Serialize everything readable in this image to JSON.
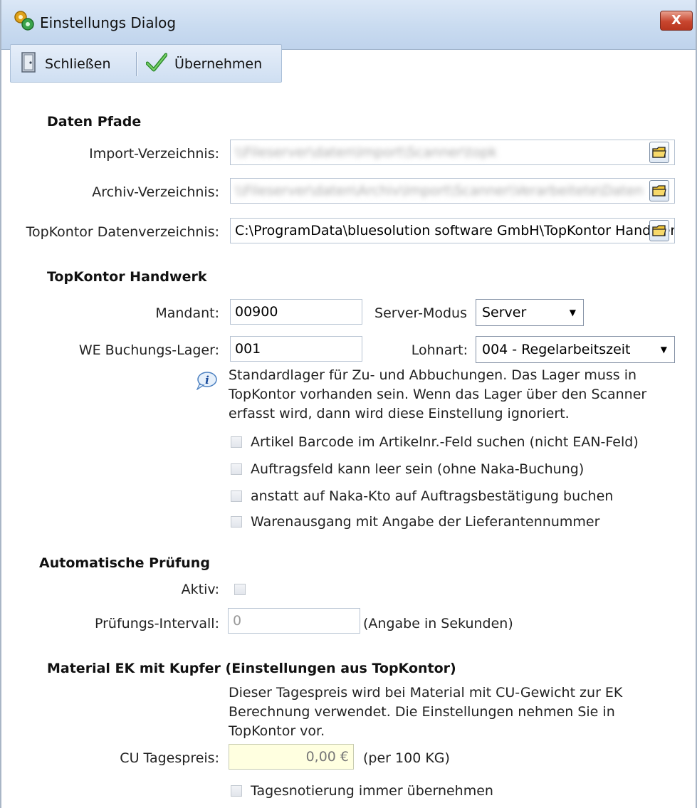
{
  "window": {
    "title": "Einstellungs Dialog",
    "close_symbol": "X"
  },
  "toolbar": {
    "close_label": "Schließen",
    "apply_label": "Übernehmen"
  },
  "paths": {
    "heading": "Daten Pfade",
    "import_label": "Import-Verzeichnis:",
    "import_value": "\\\\Fileserver\\daten\\Import\\Scanner\\topk",
    "archive_label": "Archiv-Verzeichnis:",
    "archive_value": "\\\\Fileserver\\daten\\Archiv\\Import\\Scanner\\Verarbeitete\\Daten",
    "topkontor_label": "TopKontor Datenverzeichnis:",
    "topkontor_value": "C:\\ProgramData\\bluesolution software GmbH\\TopKontor Handwerk"
  },
  "handwerk": {
    "heading": "TopKontor Handwerk",
    "mandant_label": "Mandant:",
    "mandant_value": "00900",
    "server_mode_label": "Server-Modus",
    "server_mode_value": "Server",
    "lager_label": "WE Buchungs-Lager:",
    "lager_value": "001",
    "lohnart_label": "Lohnart:",
    "lohnart_value": "004 - Regelarbeitszeit",
    "info_lines": [
      "Standardlager für Zu- und Abbuchungen. Das Lager muss in",
      "TopKontor vorhanden sein. Wenn das Lager über den Scanner",
      "erfasst wird, dann wird diese Einstellung ignoriert."
    ],
    "checkboxes": [
      "Artikel Barcode im Artikelnr.-Feld suchen (nicht EAN-Feld)",
      "Auftragsfeld kann leer sein (ohne Naka-Buchung)",
      "anstatt auf Naka-Kto auf Auftragsbestätigung buchen",
      "Warenausgang mit Angabe der Lieferantennummer"
    ]
  },
  "auto_check": {
    "heading": "Automatische Prüfung",
    "active_label": "Aktiv:",
    "interval_label": "Prüfungs-Intervall:",
    "interval_value": "0",
    "interval_hint": "(Angabe in Sekunden)"
  },
  "material": {
    "heading": "Material EK mit Kupfer (Einstellungen aus TopKontor)",
    "info_lines": [
      "Dieser Tagespreis wird bei Material mit CU-Gewicht zur EK",
      "Berechnung verwendet.  Die Einstellungen nehmen Sie in",
      "TopKontor vor."
    ],
    "price_label": "CU Tagespreis:",
    "price_value": "0,00 €",
    "price_hint": "(per 100 KG)",
    "checkbox_label": "Tagesnotierung immer übernehmen"
  },
  "colors": {
    "accent": "#c9dbf0",
    "readonly_bg": "#ffffe0",
    "close": "#c8462f"
  }
}
